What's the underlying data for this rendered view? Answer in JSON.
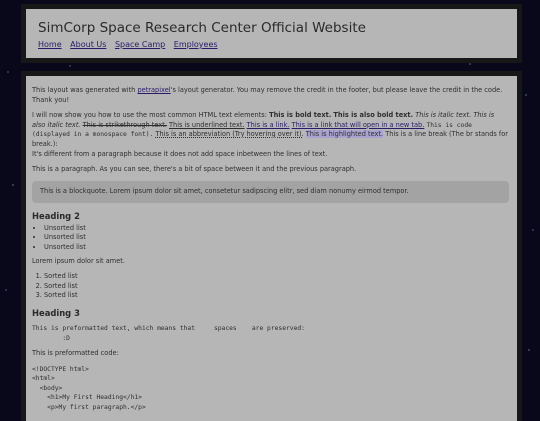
{
  "header": {
    "title": "SimCorp Space Research Center Official Website",
    "nav": [
      "Home",
      "About Us",
      "Space Camp",
      "Employees"
    ]
  },
  "content": {
    "intro_pre": "This layout was generated with ",
    "intro_link": "petrapixel",
    "intro_post": "'s layout generator. You may remove the credit in the footer, but please leave the credit in the code. Thank you!",
    "elements_intro": "I will now show you how to use the most common HTML text elements: ",
    "bold": "This is bold text.",
    "bold2": "This is also bold text.",
    "italic": "This is italic text.",
    "italic2": "This is also italic text.",
    "strike": "This is strikethrough text.",
    "underline": "This is underlined text.",
    "link": "This is a link.",
    "link_newtab": "This is a link that will open in a new tab.",
    "code": "This is code (displayed in a monospace font).",
    "abbr": "This is an abbreviation (Try hovering over it).",
    "highlight": "This is highlighted text.",
    "linebreak": "This is a line break (The br stands for break.):",
    "linebreak_after": "It's different from a paragraph because it does not add space inbetween the lines of text.",
    "paragraph": "This is a paragraph. As you can see, there's a bit of space between it and the previous paragraph.",
    "blockquote": "This is a blockquote. Lorem ipsum dolor sit amet, consetetur sadipscing elitr, sed diam nonumy eirmod tempor.",
    "heading2": "Heading 2",
    "unsorted": [
      "Unsorted list",
      "Unsorted list",
      "Unsorted list"
    ],
    "lorem": "Lorem ipsum dolor sit amet.",
    "sorted": [
      "Sorted list",
      "Sorted list",
      "Sorted list"
    ],
    "heading3": "Heading 3",
    "preformatted": "This is preformatted text, which means that     spaces    are preserved:\n        :D",
    "preformatted_code_label": "This is preformatted code:",
    "code_block": "<!DOCTYPE html>\n<html>\n  <body>\n    <h1>My First Heading</h1>\n    <p>My first paragraph.</p>"
  }
}
